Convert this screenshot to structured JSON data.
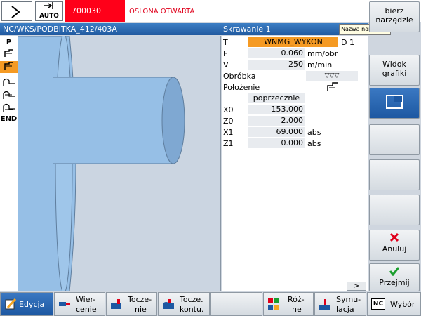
{
  "top": {
    "mode": "AUTO",
    "alarm_number": "700030",
    "alarm_text": "OSLONA OTWARTA"
  },
  "title": {
    "path": "NC/WKS/PODBITKA_412/403A",
    "section": "Skrawanie 1"
  },
  "tooltip": "Nazwa narzędzia",
  "left_icons": [
    "P",
    "END"
  ],
  "params": {
    "t_label": "T",
    "tool_name": "WNMG_WYKON",
    "d_value": "D 1",
    "f_label": "F",
    "f_value": "0.060",
    "f_unit": "mm/obr",
    "v_label": "V",
    "v_value": "250",
    "v_unit": "m/min",
    "obrobka_label": "Obróbka",
    "obrobka_value": "▽▽▽",
    "polozenie_label": "Położenie",
    "direction": "poprzecznie",
    "x0_label": "X0",
    "x0_value": "153.000",
    "z0_label": "Z0",
    "z0_value": "2.000",
    "x1_label": "X1",
    "x1_value": "69.000",
    "x1_unit": "abs",
    "z1_label": "Z1",
    "z1_value": "0.000",
    "z1_unit": "abs"
  },
  "scroll_label": ">",
  "right_softkeys": {
    "tool_line1": "bierz",
    "tool_line2": "narzędzie",
    "view_line1": "Widok",
    "view_line2": "grafiki",
    "cancel": "Anuluj",
    "accept": "Przejmij"
  },
  "bottom_softkeys": {
    "edit": "Edycja",
    "drill_1": "Wier-",
    "drill_2": "cenie",
    "turn_1": "Tocze-",
    "turn_2": "nie",
    "contour_1": "Tocze.",
    "contour_2": "kontu.",
    "misc_1": "Róż-",
    "misc_2": "ne",
    "sim_1": "Symu-",
    "sim_2": "lacja",
    "nc_badge": "NC",
    "select": "Wybór"
  },
  "colors": {
    "alarm_bg": "#ff0019",
    "alarm_text": "#e0001b",
    "title_bar": "#215aa0",
    "input_highlight": "#f59a23",
    "part": "#96bfe6"
  }
}
